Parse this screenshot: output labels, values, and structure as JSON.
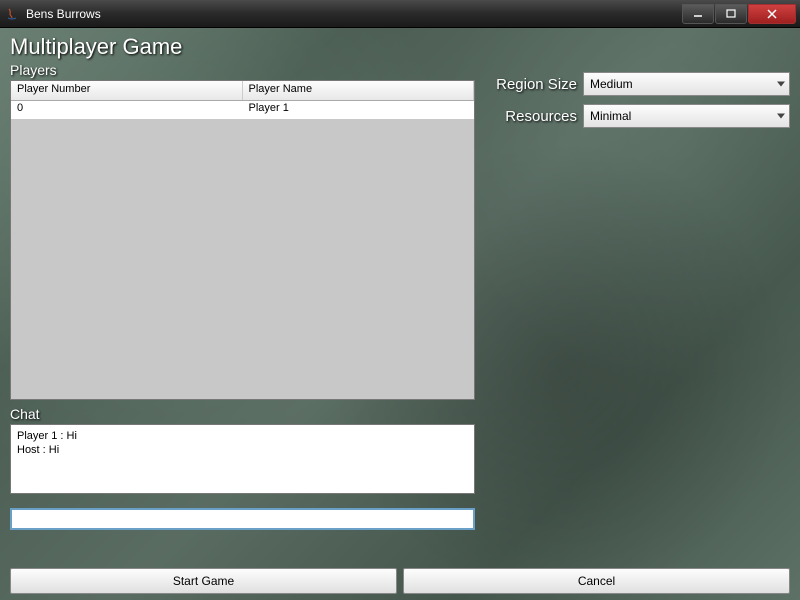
{
  "window": {
    "title": "Bens Burrows"
  },
  "page": {
    "heading": "Multiplayer Game"
  },
  "players": {
    "label": "Players",
    "columns": [
      "Player Number",
      "Player Name"
    ],
    "rows": [
      {
        "number": "0",
        "name": "Player 1"
      }
    ]
  },
  "chat": {
    "label": "Chat",
    "messages": [
      "Player 1 : Hi",
      "Host : Hi"
    ],
    "input_value": ""
  },
  "settings": {
    "region_size": {
      "label": "Region Size",
      "value": "Medium"
    },
    "resources": {
      "label": "Resources",
      "value": "Minimal"
    }
  },
  "buttons": {
    "start": "Start Game",
    "cancel": "Cancel"
  }
}
